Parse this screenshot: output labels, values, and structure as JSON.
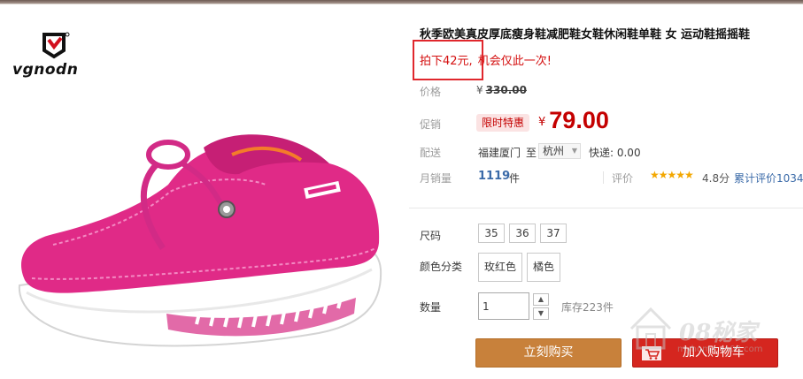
{
  "brand": {
    "name": "vgnodn"
  },
  "product": {
    "title": "秋季欧美真皮厚底瘦身鞋减肥鞋女鞋休闲鞋单鞋 女 运动鞋摇摇鞋",
    "promo_part1": "拍下42元,",
    "promo_part2": "机会仅此一次!"
  },
  "price": {
    "label": "价格",
    "currency": "¥",
    "original": "330.00"
  },
  "promotion": {
    "label": "促销",
    "tag": "限时特惠",
    "currency": "¥",
    "price": "79.00"
  },
  "shipping": {
    "label": "配送",
    "from": "福建厦门",
    "to_word": "至",
    "city": "杭州",
    "express": "快递: 0.00"
  },
  "sales": {
    "label": "月销量",
    "count": "1119",
    "unit": "件",
    "rating_label": "评价",
    "stars": "★★★★★",
    "score": "4.8分",
    "review_count": "累计评价1034"
  },
  "size": {
    "label": "尺码",
    "options": [
      "35",
      "36",
      "37"
    ]
  },
  "color": {
    "label": "颜色分类",
    "options": [
      "玫红色",
      "橘色"
    ]
  },
  "quantity": {
    "label": "数量",
    "value": "1",
    "stock": "库存223件"
  },
  "actions": {
    "buy_now": "立刻购买",
    "add_to_cart": "加入购物车"
  },
  "watermark": {
    "text": "08秘家",
    "url": "myhome.vo08.com"
  },
  "colors": {
    "accent_red": "#c40000",
    "buy_button": "#c8813b",
    "cart_button": "#d5261f",
    "link_blue": "#3a6aa8",
    "star": "#f3a700"
  }
}
